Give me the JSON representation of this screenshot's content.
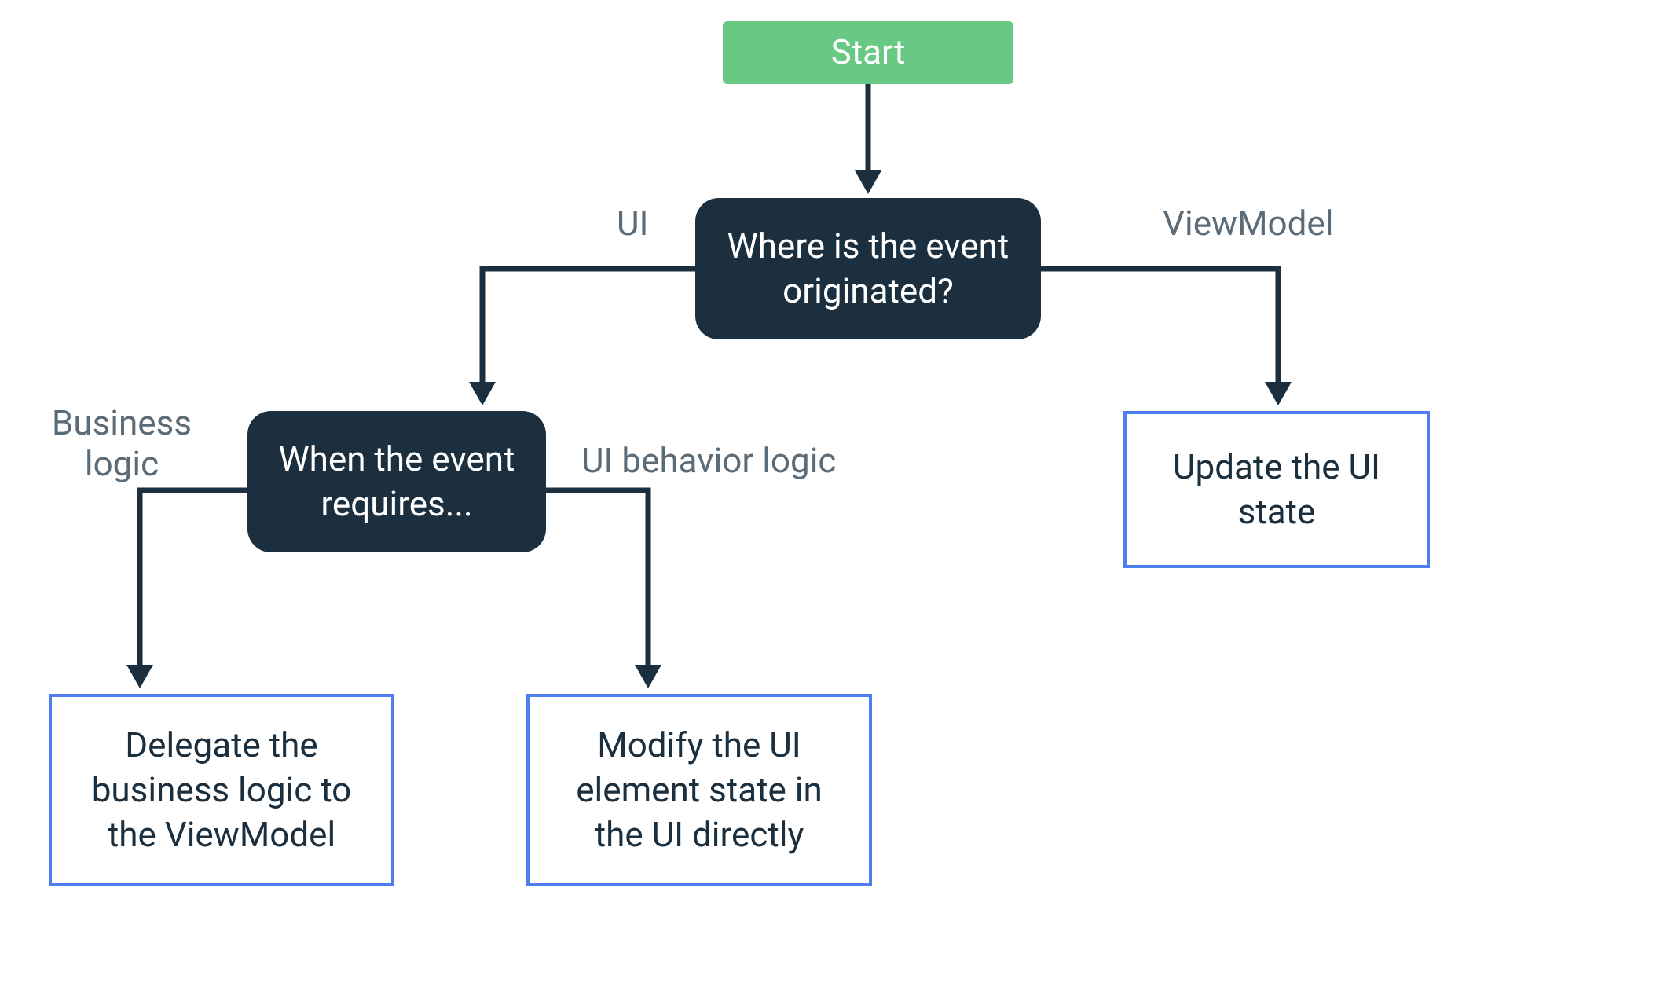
{
  "nodes": {
    "start": {
      "label": "Start"
    },
    "decision1": {
      "label": "Where is the event originated?"
    },
    "decision2": {
      "label": "When the event requires..."
    },
    "outcome_update": {
      "label": "Update the UI state"
    },
    "outcome_delegate": {
      "label": "Delegate the business logic to the ViewModel"
    },
    "outcome_modify": {
      "label": "Modify the UI element state in the UI directly"
    }
  },
  "edges": {
    "ui": {
      "label": "UI"
    },
    "viewmodel": {
      "label": "ViewModel"
    },
    "business_logic": {
      "label": "Business logic"
    },
    "ui_behavior_logic": {
      "label": "UI behavior logic"
    }
  },
  "colors": {
    "start_bg": "#67c983",
    "decision_bg": "#1b2f3f",
    "outcome_border": "#4e7ef0",
    "edge_label": "#5b6b78",
    "arrow": "#1b2f3f"
  }
}
